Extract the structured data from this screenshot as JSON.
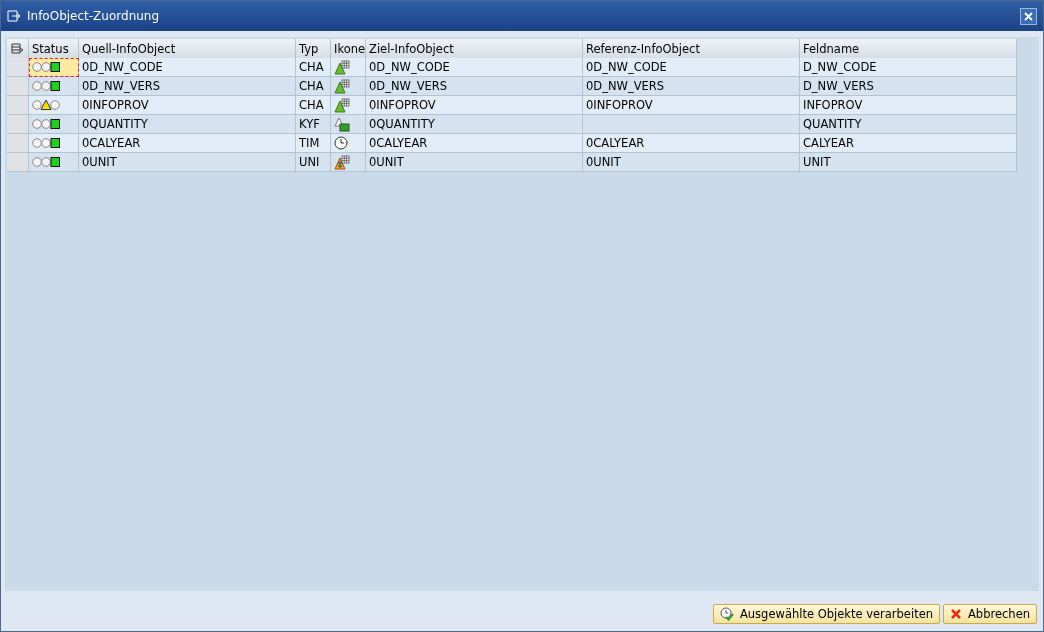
{
  "window": {
    "title": "InfoObject-Zuordnung"
  },
  "table": {
    "columns": [
      "Status",
      "Quell-InfoObject",
      "Typ",
      "Ikone",
      "Ziel-InfoObject",
      "Referenz-InfoObject",
      "Feldname"
    ],
    "rows": [
      {
        "status": {
          "kind": "green"
        },
        "focused": true,
        "source": "0D_NW_CODE",
        "type": "CHA",
        "icon": {
          "kind": "characteristic"
        },
        "target": "0D_NW_CODE",
        "reference": "0D_NW_CODE",
        "field": "D_NW_CODE"
      },
      {
        "status": {
          "kind": "green"
        },
        "focused": false,
        "source": "0D_NW_VERS",
        "type": "CHA",
        "icon": {
          "kind": "characteristic"
        },
        "target": "0D_NW_VERS",
        "reference": "0D_NW_VERS",
        "field": "D_NW_VERS"
      },
      {
        "status": {
          "kind": "yellow"
        },
        "focused": false,
        "source": "0INFOPROV",
        "type": "CHA",
        "icon": {
          "kind": "characteristic"
        },
        "target": "0INFOPROV",
        "reference": "0INFOPROV",
        "field": "INFOPROV"
      },
      {
        "status": {
          "kind": "green"
        },
        "focused": false,
        "source": "0QUANTITY",
        "type": "KYF",
        "icon": {
          "kind": "keyfigure"
        },
        "target": "0QUANTITY",
        "reference": "",
        "field": "QUANTITY"
      },
      {
        "status": {
          "kind": "green"
        },
        "focused": false,
        "source": "0CALYEAR",
        "type": "TIM",
        "icon": {
          "kind": "time"
        },
        "target": "0CALYEAR",
        "reference": "0CALYEAR",
        "field": "CALYEAR"
      },
      {
        "status": {
          "kind": "green"
        },
        "focused": false,
        "source": "0UNIT",
        "type": "UNI",
        "icon": {
          "kind": "unit"
        },
        "target": "0UNIT",
        "reference": "0UNIT",
        "field": "UNIT"
      }
    ]
  },
  "buttons": [
    {
      "label": "Ausgewählte Objekte verarbeiten",
      "kind": "confirm"
    },
    {
      "label": "Abbrechen",
      "kind": "cancel"
    }
  ]
}
